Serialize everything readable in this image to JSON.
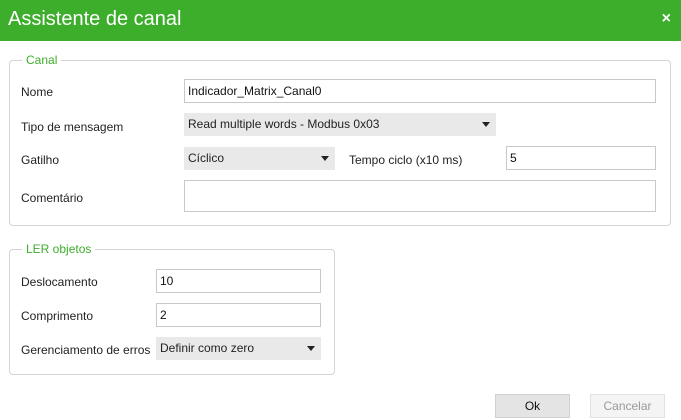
{
  "window": {
    "title": "Assistente de canal",
    "close_icon": "×"
  },
  "channel": {
    "legend": "Canal",
    "name_label": "Nome",
    "name_value": "Indicador_Matrix_Canal0",
    "msg_type_label": "Tipo de mensagem",
    "msg_type_value": "Read multiple words - Modbus 0x03",
    "trigger_label": "Gatilho",
    "trigger_value": "Cíclico",
    "cycle_label": "Tempo ciclo (x10 ms)",
    "cycle_value": "5",
    "comment_label": "Comentário",
    "comment_value": ""
  },
  "read_objects": {
    "legend": "LER objetos",
    "offset_label": "Deslocamento",
    "offset_value": "10",
    "length_label": "Comprimento",
    "length_value": "2",
    "error_label": "Gerenciamento de erros",
    "error_value": "Definir como zero"
  },
  "buttons": {
    "ok": "Ok",
    "cancel": "Cancelar"
  },
  "colors": {
    "accent": "#3dae2b"
  }
}
